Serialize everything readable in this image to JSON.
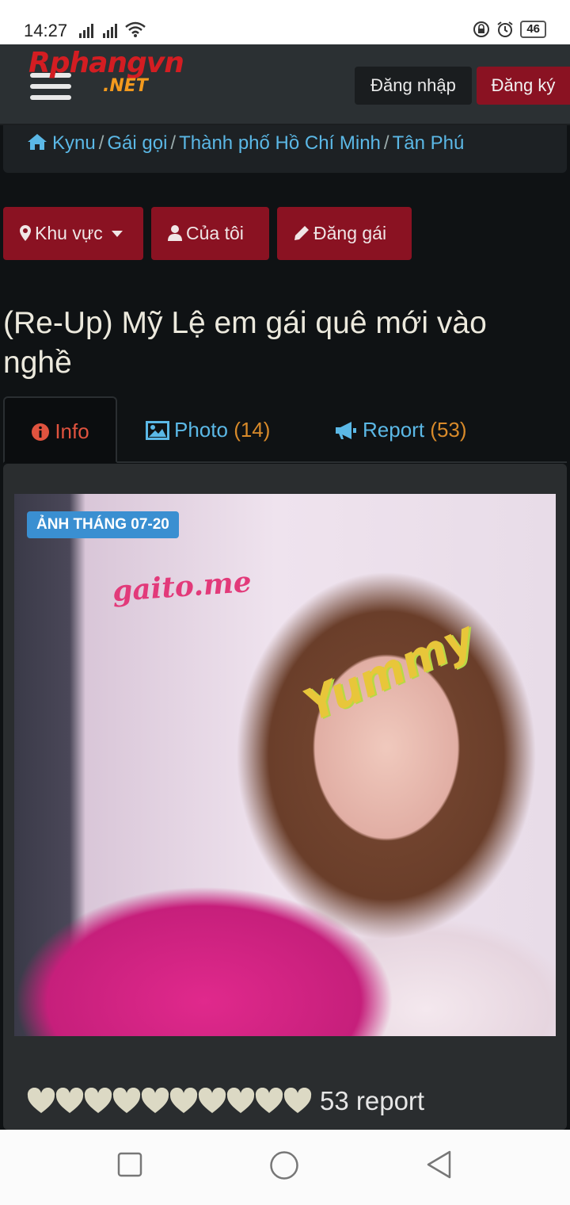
{
  "status_bar": {
    "time": "14:27",
    "battery": "46"
  },
  "header": {
    "logo_main": "Rphangvn",
    "logo_sub": ".NET",
    "login_label": "Đăng nhập",
    "register_label": "Đăng ký"
  },
  "breadcrumb": {
    "items": [
      "Kynu",
      "Gái gọi",
      "Thành phố Hồ Chí Minh",
      "Tân Phú"
    ],
    "separator": "/"
  },
  "actions": {
    "area_label": "Khu vực",
    "mine_label": "Của tôi",
    "post_label": "Đăng gái"
  },
  "page": {
    "title": "(Re-Up) Mỹ Lệ em gái quê mới vào nghề"
  },
  "tabs": {
    "info": {
      "label": "Info"
    },
    "photo": {
      "label": "Photo",
      "count": "(14)"
    },
    "report": {
      "label": "Report",
      "count": "(53)"
    }
  },
  "card": {
    "badge": "ẢNH THÁNG 07-20",
    "watermark": "gaito.me",
    "overlay_text": "Yummy",
    "rating_hearts": 10,
    "rating_text": "53 report"
  },
  "colors": {
    "accent_red": "#8a1222",
    "link_blue": "#5bb8e6",
    "count_orange": "#d88a2a",
    "active_tab": "#e0533f",
    "badge_blue": "#3a8fd1"
  },
  "icons": [
    "home-icon",
    "map-marker-icon",
    "caret-down-icon",
    "user-icon",
    "pencil-icon",
    "info-circle-icon",
    "image-icon",
    "bullhorn-icon",
    "heart-icon",
    "hamburger-menu-icon",
    "wifi-icon",
    "signal-icon",
    "alarm-icon",
    "lock-rotation-icon",
    "battery-icon",
    "nav-square-icon",
    "nav-circle-icon",
    "nav-back-icon"
  ]
}
